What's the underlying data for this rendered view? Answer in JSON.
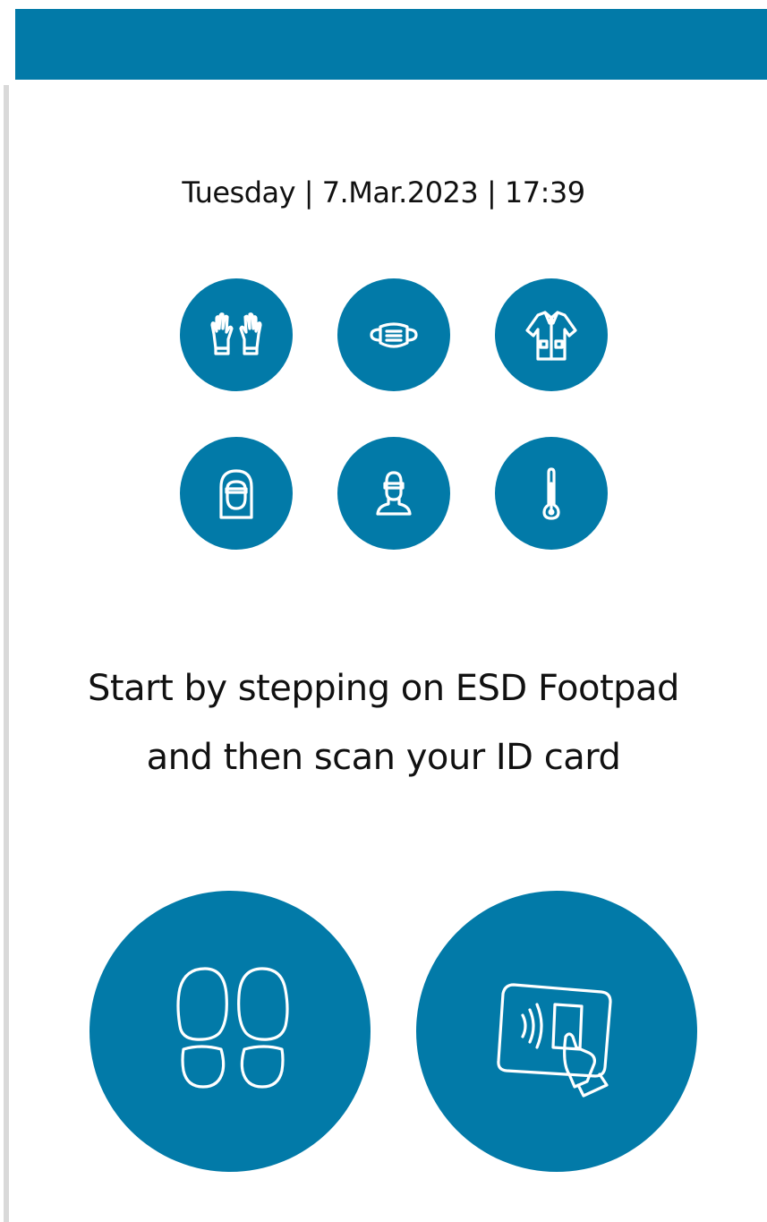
{
  "header": {
    "color": "#027aa8"
  },
  "datetime": {
    "text": "Tuesday | 7.Mar.2023 | 17:39"
  },
  "ppe_icons": [
    {
      "name": "gloves-icon"
    },
    {
      "name": "face-mask-icon"
    },
    {
      "name": "cleanroom-coat-icon"
    },
    {
      "name": "hood-icon"
    },
    {
      "name": "safety-goggles-icon"
    },
    {
      "name": "thermometer-icon"
    }
  ],
  "instruction": {
    "line1": "Start by stepping on ESD Footpad",
    "line2": "and then scan your ID card"
  },
  "actions": {
    "footpad": {
      "name": "footprints-icon"
    },
    "id_card": {
      "name": "id-card-scan-icon"
    }
  },
  "colors": {
    "accent": "#027aa8",
    "text": "#111111",
    "background": "#ffffff"
  }
}
